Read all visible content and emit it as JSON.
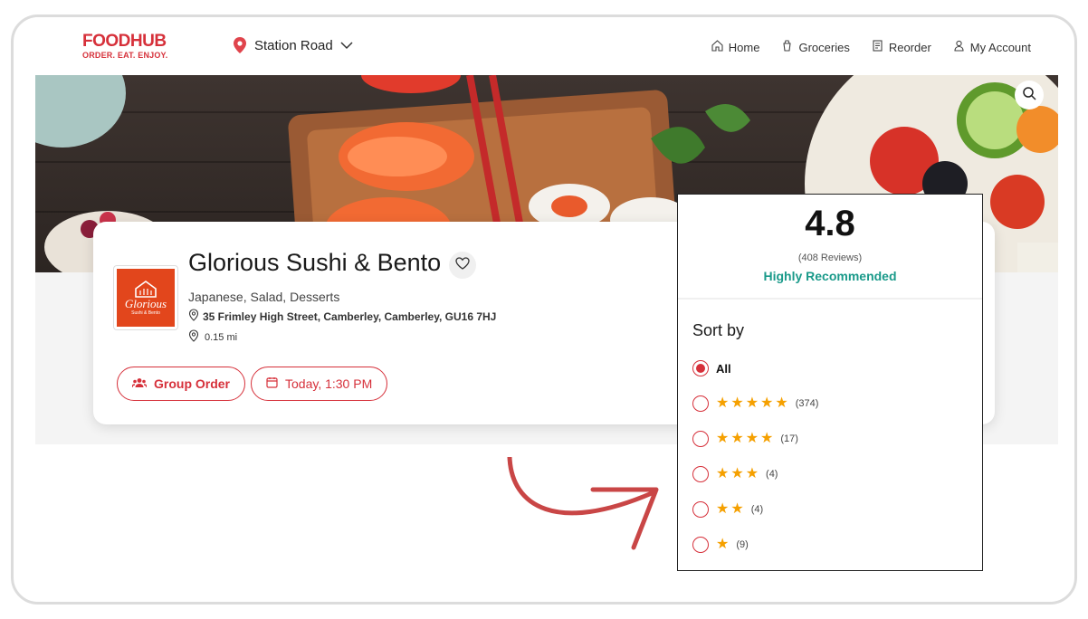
{
  "brand": {
    "name": "FOODHUB",
    "tagline": "ORDER. EAT. ENJOY.",
    "color": "#d6303a"
  },
  "location": {
    "label": "Station Road"
  },
  "nav": [
    {
      "label": "Home",
      "icon": "home-icon"
    },
    {
      "label": "Groceries",
      "icon": "grocery-icon"
    },
    {
      "label": "Reorder",
      "icon": "reorder-icon"
    },
    {
      "label": "My Account",
      "icon": "user-icon"
    }
  ],
  "restaurant": {
    "name": "Glorious Sushi & Bento",
    "logo_text": "Glorious",
    "logo_subtext": "Sushi & Bento",
    "cuisines": "Japanese, Salad, Desserts",
    "address": "35 Frimley High Street, Camberley, Camberley, GU16 7HJ",
    "distance": "0.15 mi"
  },
  "actions": {
    "group_order": "Group Order",
    "schedule": "Today, 1:30 PM"
  },
  "rating": {
    "score": "4.8",
    "reviews": "(408 Reviews)",
    "recommendation": "Highly Recommended",
    "accent": "#1a9a8a"
  },
  "sort": {
    "title": "Sort by",
    "options": [
      {
        "label": "All",
        "stars": 0,
        "count": "",
        "selected": true
      },
      {
        "label": "",
        "stars": 5,
        "count": "(374)",
        "selected": false
      },
      {
        "label": "",
        "stars": 4,
        "count": "(17)",
        "selected": false
      },
      {
        "label": "",
        "stars": 3,
        "count": "(4)",
        "selected": false
      },
      {
        "label": "",
        "stars": 2,
        "count": "(4)",
        "selected": false
      },
      {
        "label": "",
        "stars": 1,
        "count": "(9)",
        "selected": false
      }
    ]
  }
}
